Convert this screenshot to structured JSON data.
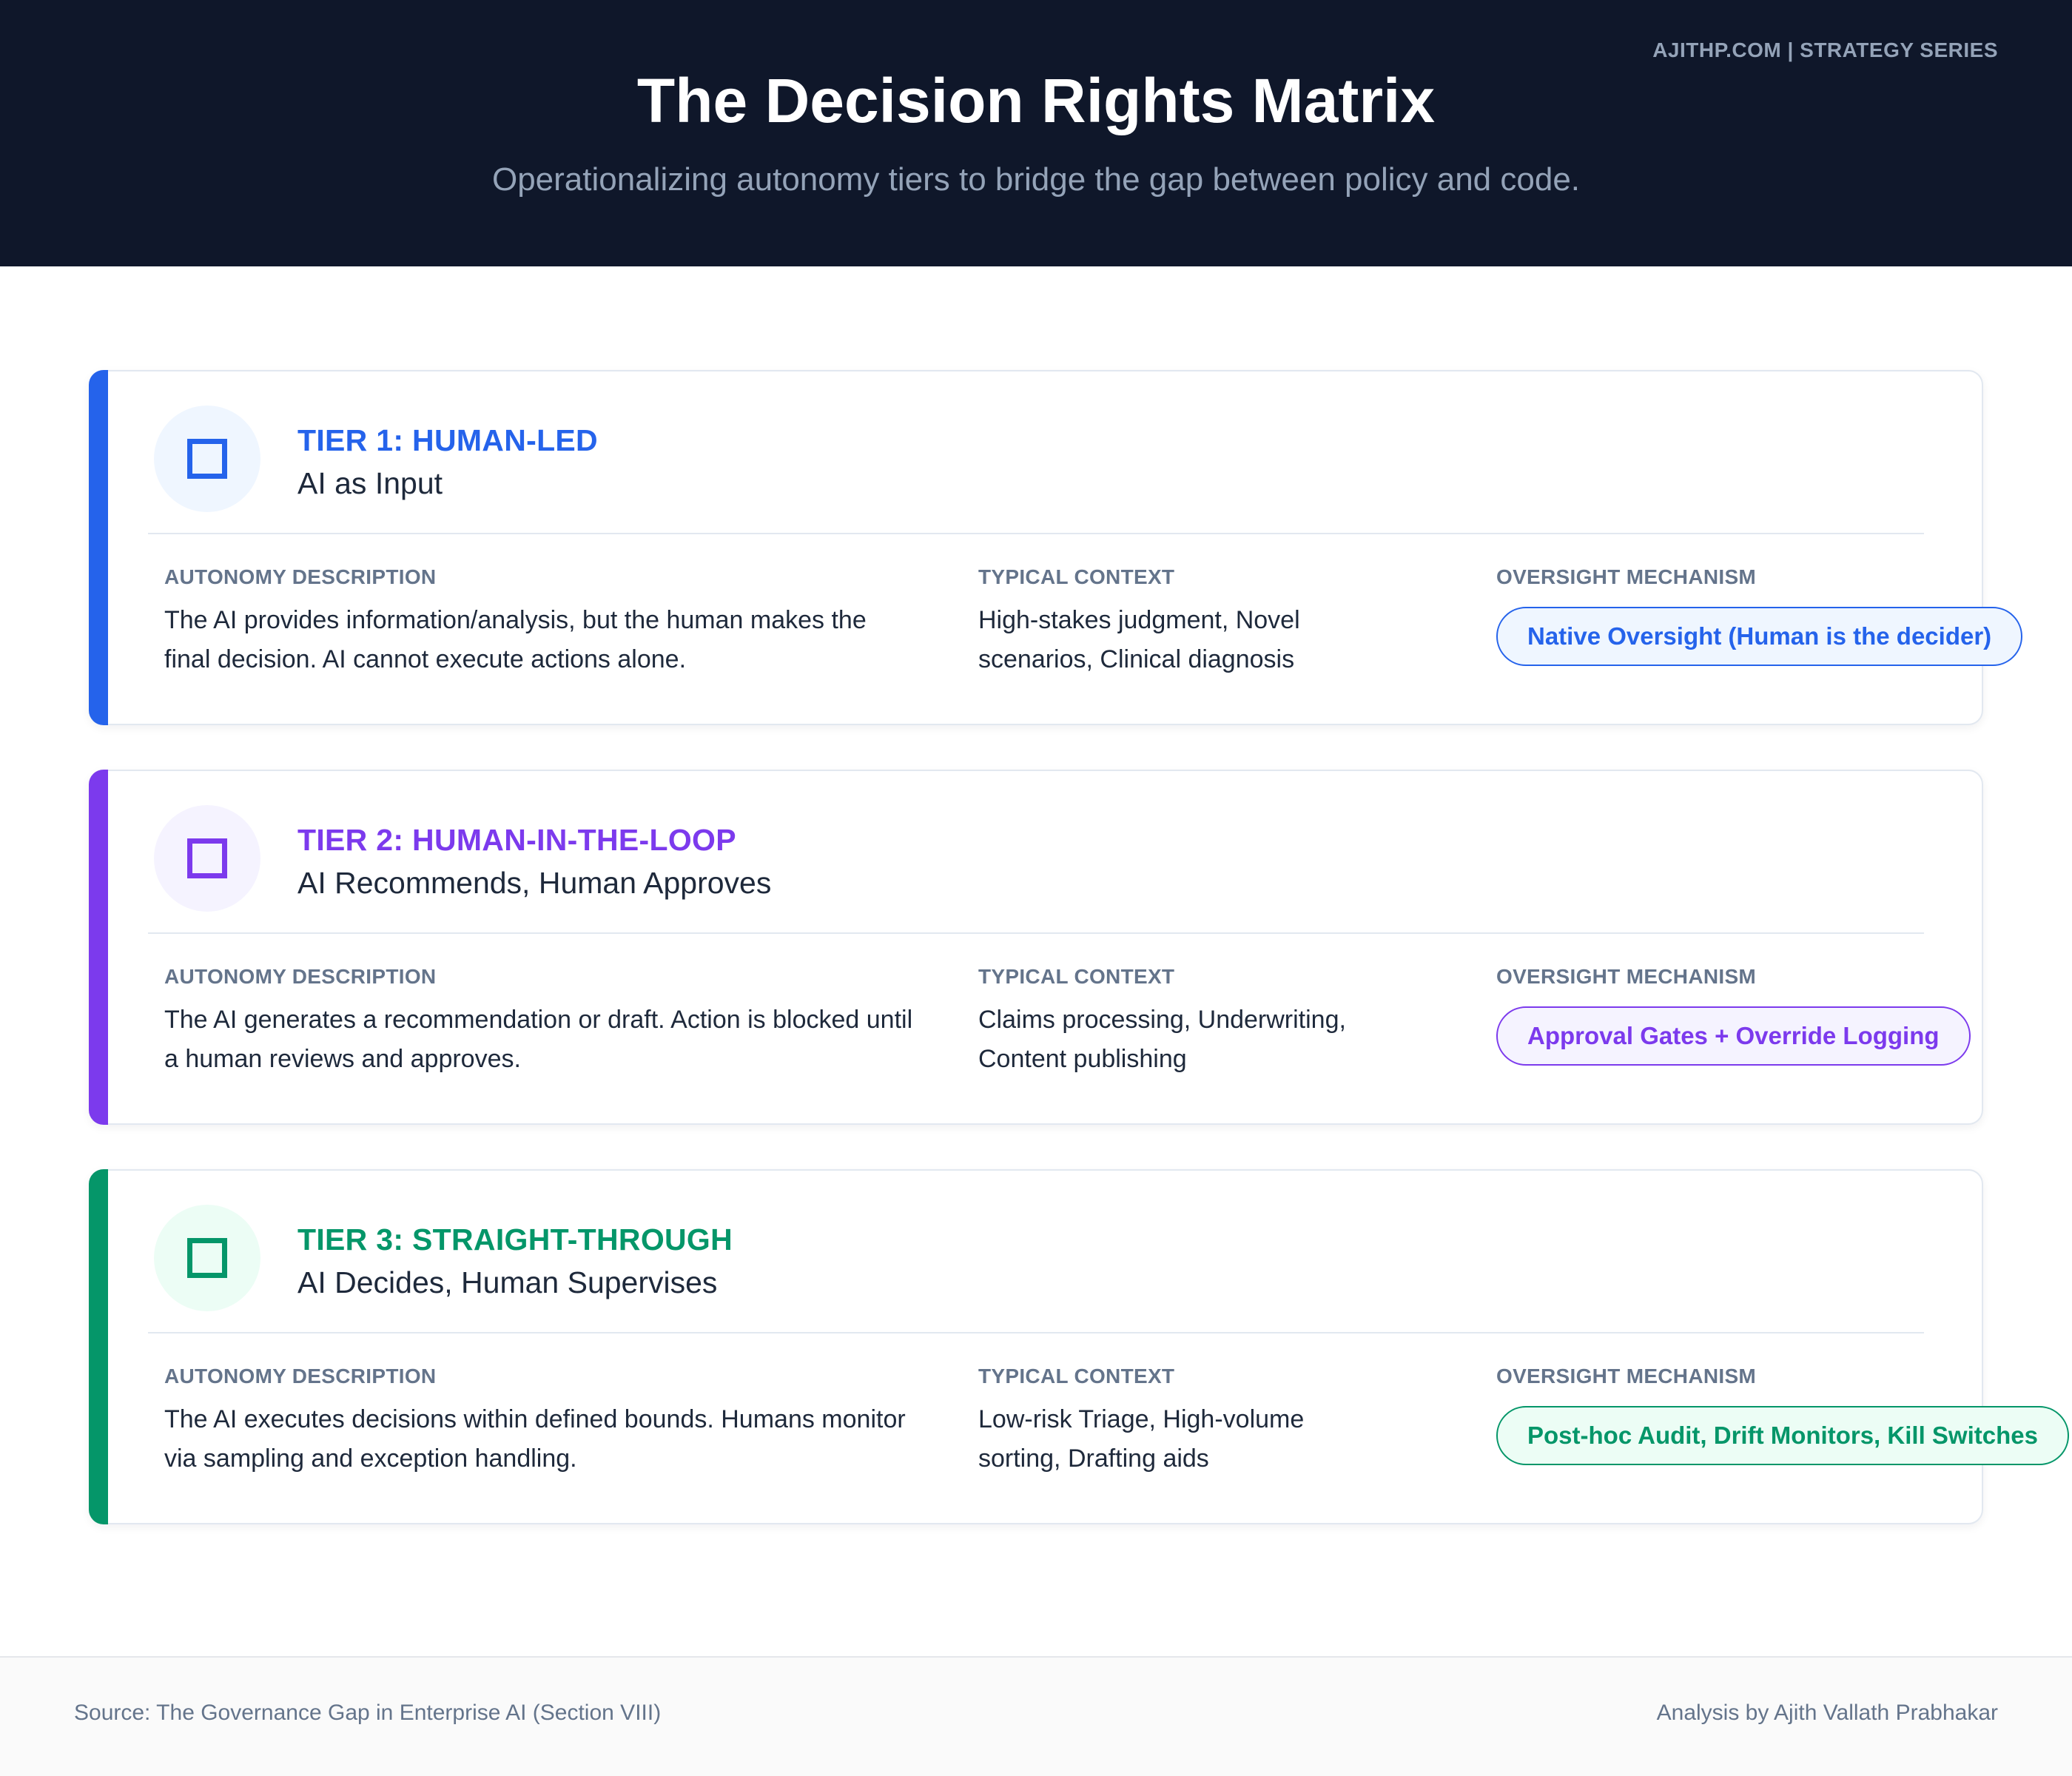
{
  "header": {
    "brand": "AJITHP.COM | STRATEGY SERIES",
    "title": "The Decision Rights Matrix",
    "subtitle": "Operationalizing autonomy tiers to bridge the gap between policy and code."
  },
  "column_labels": {
    "description": "AUTONOMY DESCRIPTION",
    "context": "TYPICAL CONTEXT",
    "oversight": "OVERSIGHT MECHANISM"
  },
  "tiers": [
    {
      "title": "TIER 1: HUMAN-LED",
      "subtitle": "AI as Input",
      "description": "The AI provides information/analysis, but the human makes the final decision. AI cannot execute actions alone.",
      "context": "High-stakes judgment, Novel scenarios, Clinical diagnosis",
      "oversight": "Native Oversight (Human is the decider)",
      "icon": "square-outline-icon",
      "accent": "#2563eb",
      "tint": "#eff6ff"
    },
    {
      "title": "TIER 2: HUMAN-IN-THE-LOOP",
      "subtitle": "AI Recommends, Human Approves",
      "description": "The AI generates a recommendation or draft. Action is blocked until a human reviews and approves.",
      "context": "Claims processing, Underwriting, Content publishing",
      "oversight": "Approval Gates + Override Logging",
      "icon": "square-outline-icon",
      "accent": "#7c3aed",
      "tint": "#f5f3ff"
    },
    {
      "title": "TIER 3: STRAIGHT-THROUGH",
      "subtitle": "AI Decides, Human Supervises",
      "description": "The AI executes decisions within defined bounds. Humans monitor via sampling and exception handling.",
      "context": "Low-risk Triage, High-volume sorting, Drafting aids",
      "oversight": "Post-hoc Audit, Drift Monitors, Kill Switches",
      "icon": "square-outline-icon",
      "accent": "#059669",
      "tint": "#ecfdf5"
    }
  ],
  "footer": {
    "source": "Source: The Governance Gap in Enterprise AI (Section VIII)",
    "author": "Analysis by Ajith Vallath Prabhakar"
  }
}
